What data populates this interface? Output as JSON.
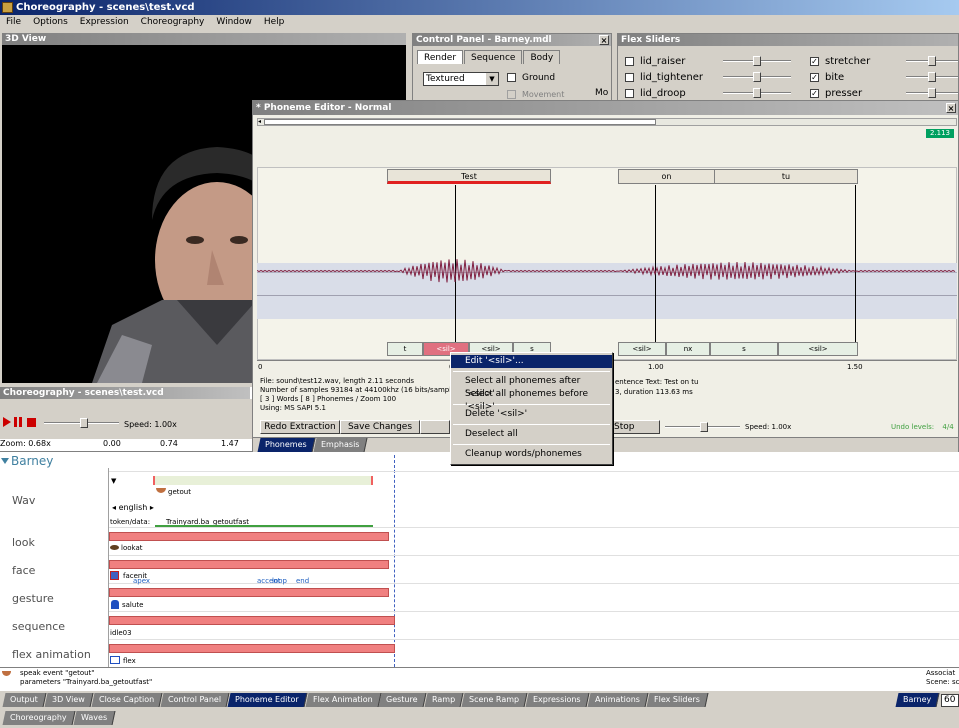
{
  "window_title": "Choreography - scenes\\test.vcd",
  "menu": [
    "File",
    "Options",
    "Expression",
    "Choreography",
    "Window",
    "Help"
  ],
  "view3d": {
    "title": "3D View"
  },
  "control_panel": {
    "title": "Control Panel - Barney.mdl",
    "tabs": [
      "Render",
      "Sequence",
      "Body"
    ],
    "render_mode": "Textured",
    "ground_label": "Ground",
    "movement_label": "Movement",
    "mo_label": "Mo"
  },
  "flex_sliders": {
    "title": "Flex Sliders",
    "left": [
      {
        "label": "lid_raiser",
        "checked": false,
        "value": 0.5
      },
      {
        "label": "lid_tightener",
        "checked": false,
        "value": 0.5
      },
      {
        "label": "lid_droop",
        "checked": false,
        "value": 0.5
      }
    ],
    "right": [
      {
        "label": "stretcher",
        "checked": true,
        "value": 0.5
      },
      {
        "label": "bite",
        "checked": true,
        "value": 0.5
      },
      {
        "label": "presser",
        "checked": true,
        "value": 0.5
      }
    ]
  },
  "phoneme_editor": {
    "title": "* Phoneme Editor - Normal",
    "time_badge": "2.113",
    "words": [
      "Test",
      "on",
      "tu"
    ],
    "phonemes": [
      "t",
      "<sil>",
      "<sil>",
      "s",
      "<sil>",
      "nx",
      "s",
      "<sil>"
    ],
    "axis_ticks": [
      "0",
      "0",
      "1.00",
      "1.50"
    ],
    "info_left": [
      "File: sound\\test12.wav, length 2.11 seconds",
      "Number of samples 93184 at 44100khz (16 bits/sample)",
      "[ 3 ] Words [ 8 ] Phonemes / Zoom 100",
      "Using: MS SAPI 5.1"
    ],
    "info_right": [
      "entence Text:  Test on tu",
      "3, duration 113.63 ms"
    ],
    "buttons": {
      "redo": "Redo Extraction",
      "save": "Save Changes",
      "stop": "Stop"
    },
    "speed": "Speed: 1.00x",
    "undo": "Undo levels:",
    "undo_value": "4/4",
    "tabs": [
      "Phonemes",
      "Emphasis"
    ]
  },
  "context_menu": {
    "items": [
      "Edit '<sil>'...",
      "Select all phonemes after '<sil>'",
      "Select all phonemes before '<sil>'",
      "Delete '<sil>'",
      "Deselect all",
      "Cleanup words/phonemes"
    ]
  },
  "choreo": {
    "title": "Choreography - scenes\\test.vcd",
    "speed": "Speed: 1.00x",
    "zoom": "Zoom: 0.68x",
    "ticks": [
      "0.00",
      "0.74",
      "1.47"
    ],
    "actor": "Barney",
    "tracks": [
      "Wav",
      "look",
      "face",
      "gesture",
      "sequence",
      "flex animation"
    ],
    "events": {
      "getout": "getout",
      "english": "english",
      "token_label": "token/data:",
      "token_value": "Trainyard.ba_getoutfast",
      "lookat": "lookat",
      "facenit": "facenit",
      "apex": "apex",
      "accent": "accent",
      "loop": "loop",
      "end": "end",
      "salute": "salute",
      "idle": "idle03",
      "flex": "flex"
    }
  },
  "status": {
    "line1": "speak event \"getout\"",
    "line2": "parameters \"Trainyard.ba_getoutfast\"",
    "right1": "Associat",
    "right2": "Scene:",
    "right3": "scen"
  },
  "bottom_tabs_row1": [
    "Output",
    "3D View",
    "Close Caption",
    "Control Panel",
    "Phoneme Editor",
    "Flex Animation",
    "Gesture",
    "Ramp",
    "Scene Ramp",
    "Expressions",
    "Animations",
    "Flex Sliders"
  ],
  "bottom_tabs_row2": [
    "Choreography",
    "Waves"
  ],
  "actor_tab": "Barney",
  "corner_value": "60"
}
